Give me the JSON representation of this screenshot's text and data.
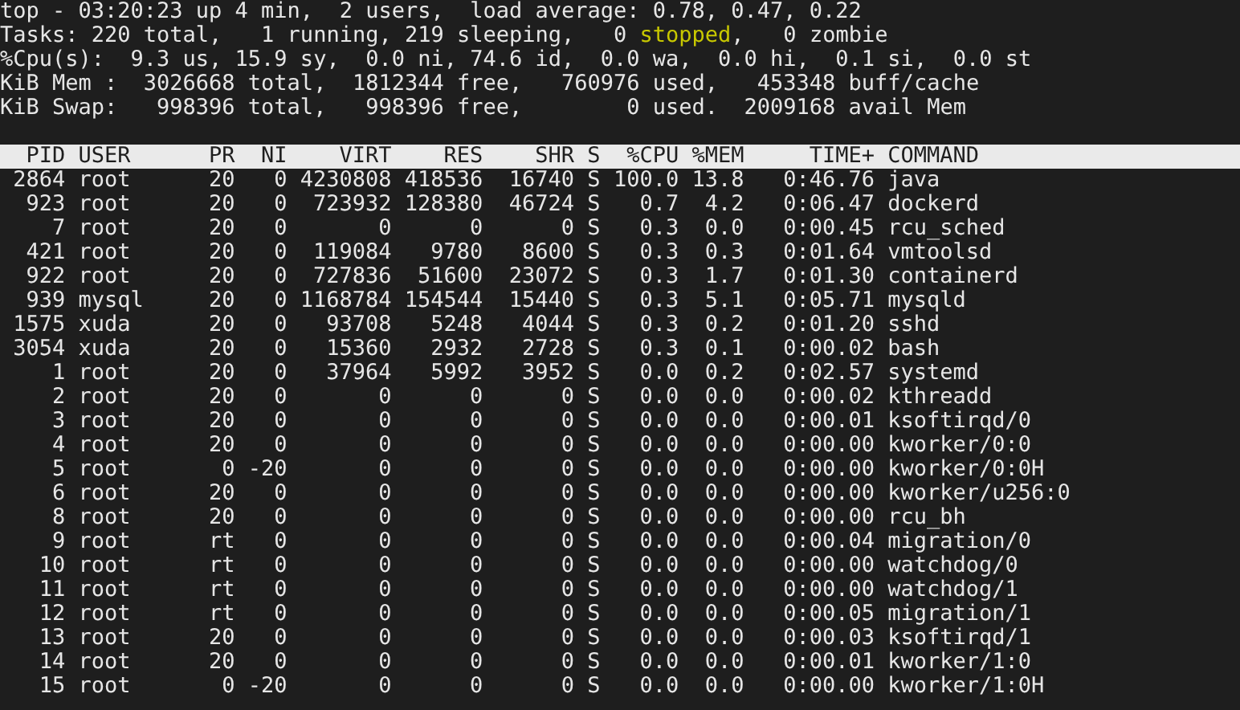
{
  "summary": [
    {
      "segments": [
        {
          "text": "top - 03:20:23 up 4 min,  2 users,  load average: 0.78, 0.47, 0.22",
          "highlight": false
        }
      ]
    },
    {
      "segments": [
        {
          "text": "Tasks: 220 total,   1 running, 219 sleeping,   0 ",
          "highlight": false
        },
        {
          "text": "stopped",
          "highlight": true
        },
        {
          "text": ",   0 zombie",
          "highlight": false
        }
      ]
    },
    {
      "segments": [
        {
          "text": "%Cpu(s):  9.3 us, 15.9 sy,  0.0 ni, 74.6 id,  0.0 wa,  0.0 hi,  0.1 si,  0.0 st",
          "highlight": false
        }
      ]
    },
    {
      "segments": [
        {
          "text": "KiB Mem :  3026668 total,  1812344 free,   760976 used,   453348 buff/cache",
          "highlight": false
        }
      ]
    },
    {
      "segments": [
        {
          "text": "KiB Swap:   998396 total,   998396 free,        0 used.  2009168 avail Mem",
          "highlight": false
        }
      ]
    }
  ],
  "table": {
    "columns": [
      "PID",
      "USER",
      "PR",
      "NI",
      "VIRT",
      "RES",
      "SHR",
      "S",
      "%CPU",
      "%MEM",
      "TIME+",
      "COMMAND"
    ],
    "rows": [
      [
        "2864",
        "root",
        "20",
        "0",
        "4230808",
        "418536",
        "16740",
        "S",
        "100.0",
        "13.8",
        "0:46.76",
        "java"
      ],
      [
        "923",
        "root",
        "20",
        "0",
        "723932",
        "128380",
        "46724",
        "S",
        "0.7",
        "4.2",
        "0:06.47",
        "dockerd"
      ],
      [
        "7",
        "root",
        "20",
        "0",
        "0",
        "0",
        "0",
        "S",
        "0.3",
        "0.0",
        "0:00.45",
        "rcu_sched"
      ],
      [
        "421",
        "root",
        "20",
        "0",
        "119084",
        "9780",
        "8600",
        "S",
        "0.3",
        "0.3",
        "0:01.64",
        "vmtoolsd"
      ],
      [
        "922",
        "root",
        "20",
        "0",
        "727836",
        "51600",
        "23072",
        "S",
        "0.3",
        "1.7",
        "0:01.30",
        "containerd"
      ],
      [
        "939",
        "mysql",
        "20",
        "0",
        "1168784",
        "154544",
        "15440",
        "S",
        "0.3",
        "5.1",
        "0:05.71",
        "mysqld"
      ],
      [
        "1575",
        "xuda",
        "20",
        "0",
        "93708",
        "5248",
        "4044",
        "S",
        "0.3",
        "0.2",
        "0:01.20",
        "sshd"
      ],
      [
        "3054",
        "xuda",
        "20",
        "0",
        "15360",
        "2932",
        "2728",
        "S",
        "0.3",
        "0.1",
        "0:00.02",
        "bash"
      ],
      [
        "1",
        "root",
        "20",
        "0",
        "37964",
        "5992",
        "3952",
        "S",
        "0.0",
        "0.2",
        "0:02.57",
        "systemd"
      ],
      [
        "2",
        "root",
        "20",
        "0",
        "0",
        "0",
        "0",
        "S",
        "0.0",
        "0.0",
        "0:00.02",
        "kthreadd"
      ],
      [
        "3",
        "root",
        "20",
        "0",
        "0",
        "0",
        "0",
        "S",
        "0.0",
        "0.0",
        "0:00.01",
        "ksoftirqd/0"
      ],
      [
        "4",
        "root",
        "20",
        "0",
        "0",
        "0",
        "0",
        "S",
        "0.0",
        "0.0",
        "0:00.00",
        "kworker/0:0"
      ],
      [
        "5",
        "root",
        "0",
        "-20",
        "0",
        "0",
        "0",
        "S",
        "0.0",
        "0.0",
        "0:00.00",
        "kworker/0:0H"
      ],
      [
        "6",
        "root",
        "20",
        "0",
        "0",
        "0",
        "0",
        "S",
        "0.0",
        "0.0",
        "0:00.00",
        "kworker/u256:0"
      ],
      [
        "8",
        "root",
        "20",
        "0",
        "0",
        "0",
        "0",
        "S",
        "0.0",
        "0.0",
        "0:00.00",
        "rcu_bh"
      ],
      [
        "9",
        "root",
        "rt",
        "0",
        "0",
        "0",
        "0",
        "S",
        "0.0",
        "0.0",
        "0:00.04",
        "migration/0"
      ],
      [
        "10",
        "root",
        "rt",
        "0",
        "0",
        "0",
        "0",
        "S",
        "0.0",
        "0.0",
        "0:00.00",
        "watchdog/0"
      ],
      [
        "11",
        "root",
        "rt",
        "0",
        "0",
        "0",
        "0",
        "S",
        "0.0",
        "0.0",
        "0:00.00",
        "watchdog/1"
      ],
      [
        "12",
        "root",
        "rt",
        "0",
        "0",
        "0",
        "0",
        "S",
        "0.0",
        "0.0",
        "0:00.05",
        "migration/1"
      ],
      [
        "13",
        "root",
        "20",
        "0",
        "0",
        "0",
        "0",
        "S",
        "0.0",
        "0.0",
        "0:00.03",
        "ksoftirqd/1"
      ],
      [
        "14",
        "root",
        "20",
        "0",
        "0",
        "0",
        "0",
        "S",
        "0.0",
        "0.0",
        "0:00.01",
        "kworker/1:0"
      ],
      [
        "15",
        "root",
        "0",
        "-20",
        "0",
        "0",
        "0",
        "S",
        "0.0",
        "0.0",
        "0:00.00",
        "kworker/1:0H"
      ]
    ]
  }
}
